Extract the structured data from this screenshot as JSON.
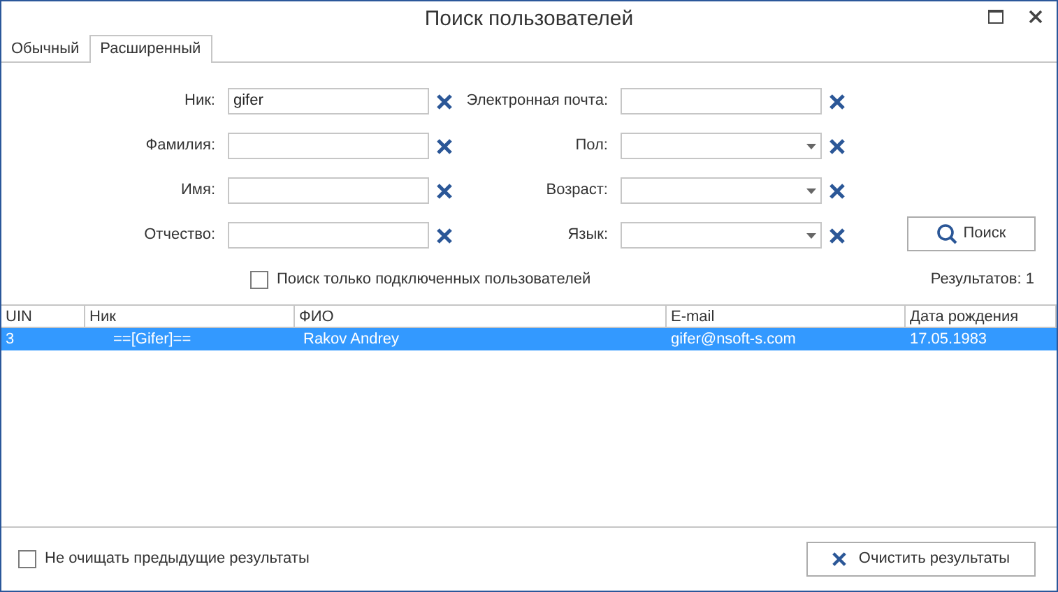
{
  "window": {
    "title": "Поиск пользователей"
  },
  "tabs": [
    {
      "label": "Обычный",
      "selected": false
    },
    {
      "label": "Расширенный",
      "selected": true
    }
  ],
  "form": {
    "rows": [
      [
        {
          "label": "Ник:",
          "kind": "text",
          "value": "gifer"
        },
        {
          "label": "Электронная почта:",
          "kind": "text"
        }
      ],
      [
        {
          "label": "Фамилия:",
          "kind": "text"
        },
        {
          "label": "Пол:",
          "kind": "select"
        }
      ],
      [
        {
          "label": "Имя:",
          "kind": "text"
        },
        {
          "label": "Возраст:",
          "kind": "select"
        }
      ],
      [
        {
          "label": "Отчество:",
          "kind": "text"
        },
        {
          "label": "Язык:",
          "kind": "select"
        }
      ]
    ],
    "search_button": "Поиск",
    "online_only": {
      "label": "Поиск только подключенных пользователей",
      "checked": false
    },
    "results_count": "Результатов: 1"
  },
  "table": {
    "columns": [
      "UIN",
      "Ник",
      "ФИО",
      "E-mail",
      "Дата рождения"
    ],
    "rows": [
      {
        "cells": [
          "3",
          "==[Gifer]==",
          "Rakov Andrey",
          "gifer@nsoft-s.com",
          "17.05.1983"
        ],
        "selected": true
      }
    ]
  },
  "footer": {
    "keep_results": {
      "label": "Не очищать предыдущие результаты",
      "checked": false
    },
    "clear_button": "Очистить результаты"
  }
}
